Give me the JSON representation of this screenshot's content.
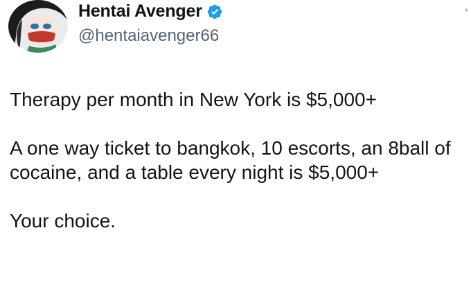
{
  "author": {
    "display_name": "Hentai Avenger",
    "handle": "@hentaiavenger66",
    "verified": true,
    "verified_icon": "verified-badge-icon",
    "avatar": "avatar-illustration"
  },
  "tweet": {
    "paragraphs": [
      "Therapy per month in New York is $5,000+",
      "A one way ticket to bangkok, 10 escorts, an 8ball of cocaine, and a table every night is $5,000+",
      "Your choice."
    ]
  },
  "colors": {
    "text": "#0f1419",
    "secondary": "#536471",
    "verified": "#1d9bf0"
  }
}
